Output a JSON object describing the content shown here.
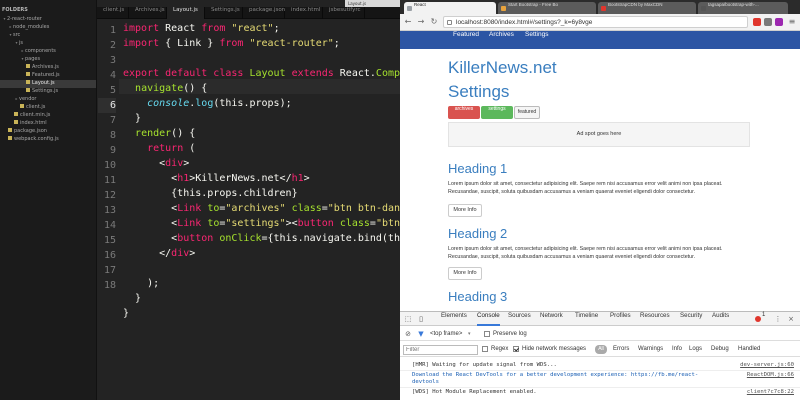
{
  "editor": {
    "sidebar_title": "FOLDERS",
    "tree": [
      {
        "label": "2-react-router",
        "depth": 0,
        "type": "folder",
        "open": true
      },
      {
        "label": "node_modules",
        "depth": 1,
        "type": "folder",
        "open": false
      },
      {
        "label": "src",
        "depth": 1,
        "type": "folder",
        "open": true
      },
      {
        "label": "js",
        "depth": 2,
        "type": "folder",
        "open": true
      },
      {
        "label": "components",
        "depth": 3,
        "type": "folder",
        "open": false
      },
      {
        "label": "pages",
        "depth": 3,
        "type": "folder",
        "open": true
      },
      {
        "label": "Archives.js",
        "depth": 4,
        "type": "file"
      },
      {
        "label": "Featured.js",
        "depth": 4,
        "type": "file"
      },
      {
        "label": "Layout.js",
        "depth": 4,
        "type": "file",
        "selected": true
      },
      {
        "label": "Settings.js",
        "depth": 4,
        "type": "file"
      },
      {
        "label": "vendor",
        "depth": 2,
        "type": "folder",
        "open": false
      },
      {
        "label": "client.js",
        "depth": 3,
        "type": "file"
      },
      {
        "label": "client.min.js",
        "depth": 2,
        "type": "file"
      },
      {
        "label": "index.html",
        "depth": 2,
        "type": "file"
      },
      {
        "label": "package.json",
        "depth": 1,
        "type": "file"
      },
      {
        "label": "webpack.config.js",
        "depth": 1,
        "type": "file"
      }
    ],
    "tabs": [
      {
        "label": "client.js"
      },
      {
        "label": "Archives.js"
      },
      {
        "label": "Layout.js",
        "active": true
      },
      {
        "label": "Settings.js"
      },
      {
        "label": "package.json"
      },
      {
        "label": "index.html"
      },
      {
        "label": "jsbesutifyrc"
      }
    ],
    "path_tip": "Layout.js",
    "current_line": 6,
    "line_numbers": [
      "1",
      "2",
      "3",
      "4",
      "5",
      "6",
      "7",
      "8",
      "9",
      "10",
      "11",
      "12",
      "13",
      "14",
      "15",
      "16",
      "17",
      "18"
    ],
    "code_lines": [
      [
        [
          "kw",
          "import"
        ],
        [
          "punc",
          " React "
        ],
        [
          "kw",
          "from"
        ],
        [
          "punc",
          " "
        ],
        [
          "str",
          "\"react\""
        ],
        [
          "punc",
          ";"
        ]
      ],
      [
        [
          "kw",
          "import"
        ],
        [
          "punc",
          " { Link } "
        ],
        [
          "kw",
          "from"
        ],
        [
          "punc",
          " "
        ],
        [
          "str",
          "\"react-router\""
        ],
        [
          "punc",
          ";"
        ]
      ],
      [],
      [
        [
          "kw",
          "export default class"
        ],
        [
          "punc",
          " "
        ],
        [
          "fn",
          "Layout"
        ],
        [
          "punc",
          " "
        ],
        [
          "kw",
          "extends"
        ],
        [
          "punc",
          " React."
        ],
        [
          "fn",
          "Component"
        ]
      ],
      [
        [
          "punc",
          "  "
        ],
        [
          "fn",
          "navigate"
        ],
        [
          "punc",
          "() {"
        ]
      ],
      [
        [
          "punc",
          "    "
        ],
        [
          "cls-it",
          "console"
        ],
        [
          "punc",
          "."
        ],
        [
          "cls",
          "log"
        ],
        [
          "punc",
          "(this.props);"
        ]
      ],
      [
        [
          "punc",
          "  }"
        ]
      ],
      [
        [
          "punc",
          "  "
        ],
        [
          "fn",
          "render"
        ],
        [
          "punc",
          "() {"
        ]
      ],
      [
        [
          "punc",
          "    "
        ],
        [
          "kw",
          "return"
        ],
        [
          "punc",
          " ("
        ]
      ],
      [
        [
          "punc",
          "      <"
        ],
        [
          "tag",
          "div"
        ],
        [
          "punc",
          ">"
        ]
      ],
      [
        [
          "punc",
          "        <"
        ],
        [
          "tag",
          "h1"
        ],
        [
          "punc",
          ">KillerNews.net</"
        ],
        [
          "tag",
          "h1"
        ],
        [
          "punc",
          ">"
        ]
      ],
      [
        [
          "punc",
          "        {this.props.children}"
        ]
      ],
      [
        [
          "punc",
          "        <"
        ],
        [
          "tag",
          "Link"
        ],
        [
          "punc",
          " "
        ],
        [
          "attr",
          "to"
        ],
        [
          "punc",
          "="
        ],
        [
          "str",
          "\"archives\""
        ],
        [
          "punc",
          " "
        ],
        [
          "attr",
          "class"
        ],
        [
          "punc",
          "="
        ],
        [
          "str",
          "\"btn btn-danger\""
        ],
        [
          "punc",
          ">"
        ]
      ],
      [
        [
          "punc",
          "        <"
        ],
        [
          "tag",
          "Link"
        ],
        [
          "punc",
          " "
        ],
        [
          "attr",
          "to"
        ],
        [
          "punc",
          "="
        ],
        [
          "str",
          "\"settings\""
        ],
        [
          "punc",
          "><"
        ],
        [
          "tag",
          "button"
        ],
        [
          "punc",
          " "
        ],
        [
          "attr",
          "class"
        ],
        [
          "punc",
          "="
        ],
        [
          "str",
          "\"btn btn-"
        ]
      ],
      [
        [
          "punc",
          "        <"
        ],
        [
          "tag",
          "button"
        ],
        [
          "punc",
          " "
        ],
        [
          "attr",
          "onClick"
        ],
        [
          "punc",
          "={this.navigate.bind(this)}>"
        ]
      ],
      [
        [
          "punc",
          "      </"
        ],
        [
          "tag",
          "div"
        ],
        [
          "punc",
          ">"
        ]
      ],
      [],
      [
        [
          "punc",
          "    );"
        ]
      ],
      [
        [
          "punc",
          "  }"
        ]
      ],
      [
        [
          "punc",
          "}"
        ]
      ]
    ]
  },
  "browser": {
    "tabs": [
      {
        "label": "React",
        "active": true,
        "color": "#9aa0a6"
      },
      {
        "label": "Start Bootstrap - Free Bo",
        "color": "#e8a33d"
      },
      {
        "label": "BootstrapCDN by MaxCDN",
        "color": "#e0362d"
      },
      {
        "label": "tagsapa/bootstrap-with-...",
        "color": "#555555"
      }
    ],
    "url": "localhost:8080/index.html#/settings?_k=6y8vge",
    "nav_links": [
      "Featured",
      "Archives",
      "Settings"
    ],
    "brand_color": "#2c55a4",
    "site_title": "KillerNews.net",
    "page_heading": "Settings",
    "buttons": {
      "archives": "archives",
      "settings": "settings",
      "featured": "featured"
    },
    "ad_spot": "Ad spot goes here",
    "sections": [
      {
        "heading": "Heading 1",
        "body": "Lorem ipsum dolor sit amet, consectetur adipisicing elit. Saepe rem nisi accusamus error velit animi non ipsa placeat. Recusandae, suscipit, soluta quibusdam accusamus a veniam quaerat eveniet eligendi dolor consectetur.",
        "button": "More Info"
      },
      {
        "heading": "Heading 2",
        "body": "Lorem ipsum dolor sit amet, consectetur adipisicing elit. Saepe rem nisi accusamus error velit animi non ipsa placeat. Recusandae, suscipit, soluta quibusdam accusamus a veniam quaerat eveniet eligendi dolor consectetur.",
        "button": "More Info"
      },
      {
        "heading": "Heading 3"
      }
    ]
  },
  "devtools": {
    "tabs": [
      "Elements",
      "Console",
      "Sources",
      "Network",
      "Timeline",
      "Profiles",
      "Resources",
      "Security",
      "Audits"
    ],
    "active_tab": "Console",
    "error_count": "1",
    "context": "<top frame>",
    "preserve_log": "Preserve log",
    "filter_placeholder": "Filter",
    "regex": "Regex",
    "hide_network": "Hide network messages",
    "levels": [
      "All",
      "Errors",
      "Warnings",
      "Info",
      "Logs",
      "Debug",
      "Handled"
    ],
    "console": [
      {
        "text": "[HMR] Waiting for update signal from WDS...",
        "source": "dev-server.js:60"
      },
      {
        "text": "Download the React DevTools for a better development experience: https://fb.me/react-",
        "text2": "devtools",
        "source": "ReactDOM.js:66"
      },
      {
        "text": "[WDS] Hot Module Replacement enabled.",
        "source": "client?c7c8:22"
      }
    ]
  }
}
